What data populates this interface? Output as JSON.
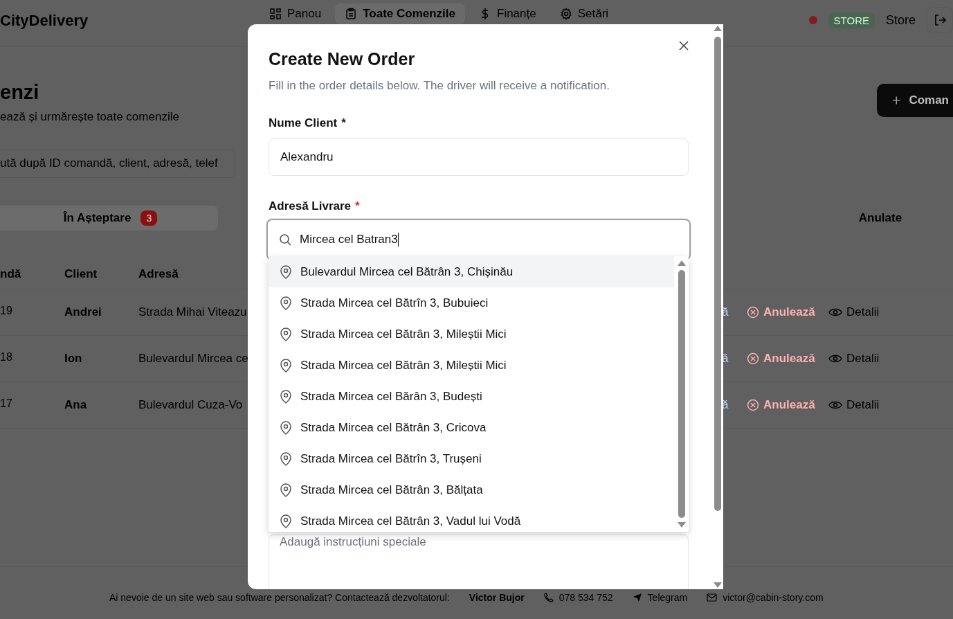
{
  "header": {
    "brand": "CityDelivery",
    "nav": [
      {
        "label": "Panou",
        "selected": false
      },
      {
        "label": "Toate Comenzile",
        "selected": true
      },
      {
        "label": "Finanțe",
        "selected": false
      },
      {
        "label": "Setări",
        "selected": false
      }
    ],
    "badge": "STORE",
    "user": "Store"
  },
  "page": {
    "title": "enzi",
    "subtitle": "ează și urmărește toate comenzile",
    "new_button": "Coman",
    "search": {
      "placeholder": "ută după ID comandă, client, adresă, telef"
    },
    "tabs": [
      {
        "label": "În Așteptare",
        "count": "3",
        "selected": true
      },
      {
        "label": "Anulate",
        "selected": false
      }
    ]
  },
  "table": {
    "columns": [
      "ndă",
      "Client",
      "Adresă"
    ],
    "rows": [
      {
        "id": "19",
        "client": "Andrei",
        "address": "Strada Mihai Viteazu",
        "assign": "ă",
        "cancel": "Anulează",
        "details": "Detalii"
      },
      {
        "id": "18",
        "client": "Ion",
        "address": "Bulevardul Mircea ce",
        "assign": "ă",
        "cancel": "Anulează",
        "details": "Detalii"
      },
      {
        "id": "17",
        "client": "Ana",
        "address": "Bulevardul Cuza-Vo",
        "assign": "ă",
        "cancel": "Anulează",
        "details": "Detalii"
      }
    ]
  },
  "footer": {
    "text": "Ai nevoie de un site web sau software personalizat? Contactează dezvoltatorul:",
    "name": "Victor Bujor",
    "phone": "078 534 752",
    "telegram": "Telegram",
    "email": "victor@cabin-story.com"
  },
  "modal": {
    "title": "Create New Order",
    "subtitle": "Fill in the order details below. The driver will receive a notification.",
    "fields": [
      {
        "label": "Nume Client",
        "required": "*",
        "color": "#111827",
        "value": "Alexandru",
        "focused": false
      },
      {
        "label": "Adresă Livrare",
        "required": "*",
        "color": "#dc2626",
        "value": "Mircea cel Batran3",
        "focused": true
      }
    ],
    "suggestions": [
      {
        "label": "Bulevardul Mircea cel Bătrân 3, Chișinău",
        "selected": true
      },
      {
        "label": "Strada Mircea cel Bătrîn 3, Bubuieci",
        "selected": false
      },
      {
        "label": "Strada Mircea cel Bătrân 3, Mileștii Mici",
        "selected": false
      },
      {
        "label": "Strada Mircea cel Bătrân 3, Mileștii Mici",
        "selected": false
      },
      {
        "label": "Strada Mircea cel Bărân 3, Budești",
        "selected": false
      },
      {
        "label": "Strada Mircea cel Bătrân 3, Cricova",
        "selected": false
      },
      {
        "label": "Strada Mircea cel Bătrîn 3, Trușeni",
        "selected": false
      },
      {
        "label": "Strada Mircea cel Bătrân 3, Bălțata",
        "selected": false
      },
      {
        "label": "Strada Mircea cel Bătrân 3, Vadul lui Vodă",
        "selected": false
      }
    ],
    "notes": {
      "placeholder": "Adaugă instrucțiuni speciale"
    }
  }
}
